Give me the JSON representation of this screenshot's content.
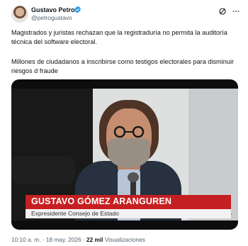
{
  "author": {
    "name": "Gustavo Petro",
    "handle": "@petrogustavo",
    "verified_color": "#1d9bf0"
  },
  "tweet": {
    "paragraph1": "Magistrados y juristas rechazan que la registraduría no permita la auditoría técnica del software electoral.",
    "paragraph2": "Millones de ciudadanos a inscribirse como testigos electorales para disminuir riesgos d fraude"
  },
  "video": {
    "lower_third_name": "GUSTAVO GÓMEZ ARANGUREN",
    "lower_third_title": "Expresidente Consejo de Estado",
    "lower_third_color": "#c51f22"
  },
  "meta": {
    "time": "10:10 a. m.",
    "separator": "·",
    "date": "18 may. 2026",
    "views_count": "22 mil",
    "views_label": "Visualizaciones"
  },
  "icons": [
    "verified-badge-icon",
    "grok-icon",
    "more-options-icon",
    "outlet-logo-icon"
  ]
}
